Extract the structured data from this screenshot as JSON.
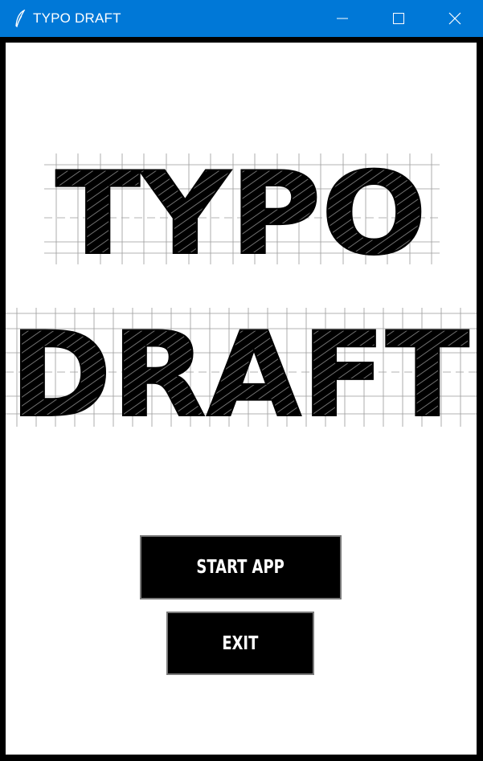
{
  "window": {
    "title": "TYPO DRAFT",
    "controls": {
      "minimize_icon": "minimize-icon",
      "maximize_icon": "maximize-icon",
      "close_icon": "close-icon"
    },
    "app_icon": "feather-icon",
    "accent_color": "#0078d7"
  },
  "logo": {
    "line1": "TYPO",
    "line2": "DRAFT"
  },
  "buttons": {
    "start_label": "START APP",
    "exit_label": "EXIT"
  }
}
